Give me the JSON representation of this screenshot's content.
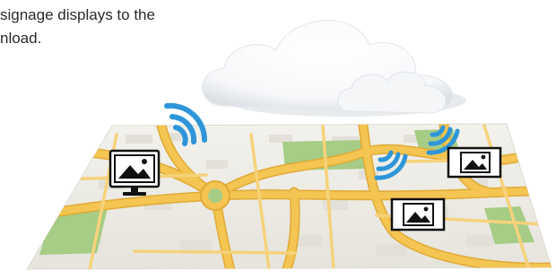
{
  "caption": {
    "line1": "signage displays to the",
    "line2": "nload."
  },
  "colors": {
    "map_base": "#ecebe4",
    "road": "#f4c552",
    "road_edge": "#e0aa35",
    "park": "#a6cc85",
    "wifi": "#2e96d8",
    "cloud": "#ffffff",
    "cloud_shade": "#e7eaee"
  },
  "icons": {
    "monitor": "desktop-monitor-image-icon",
    "display_right": "signage-display-icon",
    "display_center": "signage-display-icon",
    "wifi": "wifi-signal-icon",
    "cloud": "cloud-icon"
  }
}
